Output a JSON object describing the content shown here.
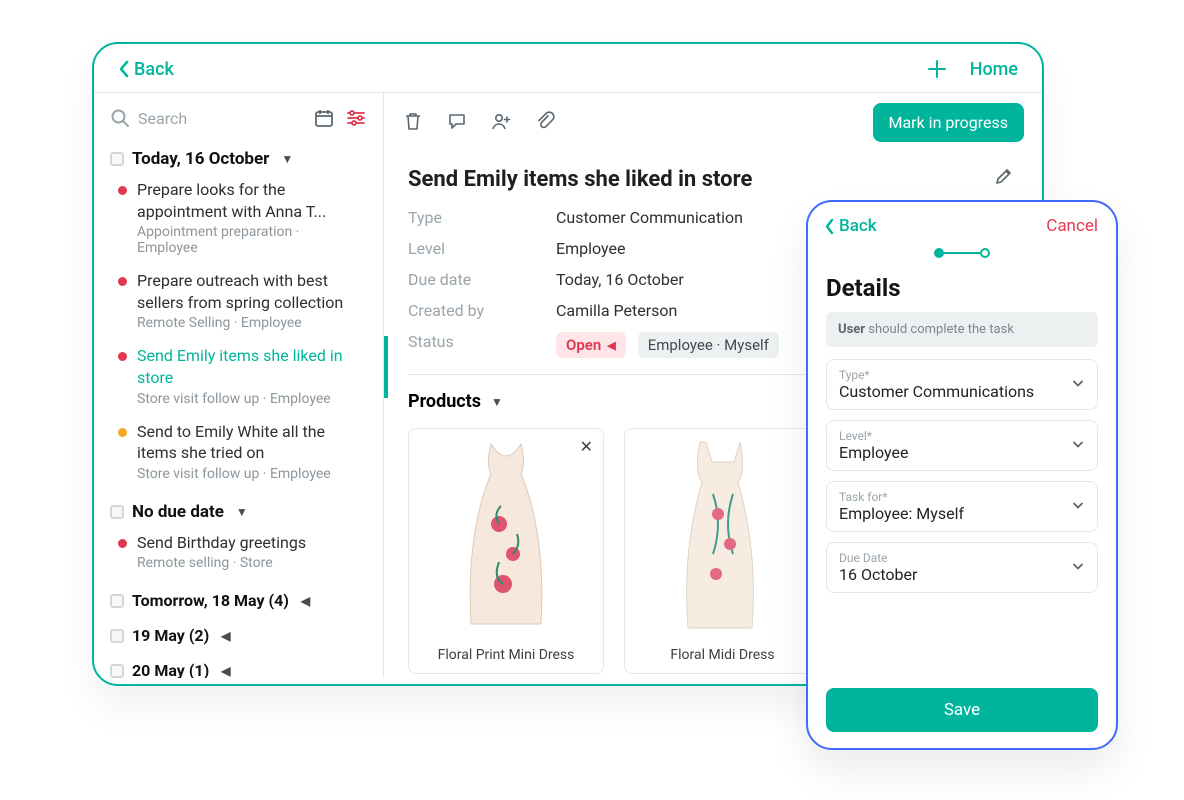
{
  "tablet": {
    "back": "Back",
    "home": "Home",
    "search_placeholder": "Search",
    "mark_in_progress": "Mark in progress",
    "groups": [
      {
        "heading": "Today, 16 October",
        "tasks": [
          {
            "dot": "red",
            "title": "Prepare looks for the appointment with Anna T...",
            "meta": "Appointment preparation · Employee"
          },
          {
            "dot": "red",
            "title": "Prepare outreach with best sellers from spring collection",
            "meta": "Remote Selling · Employee"
          },
          {
            "dot": "red",
            "title": "Send Emily items she liked in store",
            "meta": "Store visit follow up · Employee",
            "current": true
          },
          {
            "dot": "amber",
            "title": "Send to Emily White all the items she tried on",
            "meta": "Store visit follow up · Employee"
          }
        ]
      },
      {
        "heading": "No due date",
        "tasks": [
          {
            "dot": "red",
            "title": "Send Birthday greetings",
            "meta": "Remote selling · Store"
          }
        ]
      }
    ],
    "collapsed": [
      "Tomorrow, 18 May (4)",
      "19 May (2)",
      "20 May (1)"
    ],
    "detail": {
      "title": "Send Emily items she liked in store",
      "type": "Customer Communication",
      "level": "Employee",
      "due": "Today, 16 October",
      "created_by": "Camilla Peterson",
      "status_label": "Status",
      "open": "Open",
      "who": "Employee · Myself",
      "products_heading": "Products",
      "products": [
        {
          "name": "Floral Print Mini Dress"
        },
        {
          "name": "Floral Midi Dress"
        }
      ],
      "labels": {
        "type": "Type",
        "level": "Level",
        "due": "Due date",
        "created_by": "Created by"
      }
    }
  },
  "phone": {
    "back": "Back",
    "cancel": "Cancel",
    "title": "Details",
    "hint_bold": "User",
    "hint_rest": " should complete the task",
    "fields": {
      "type": {
        "label": "Type*",
        "value": "Customer Communications"
      },
      "level": {
        "label": "Level*",
        "value": "Employee"
      },
      "task_for": {
        "label": "Task for*",
        "value": "Employee: Myself"
      },
      "due": {
        "label": "Due Date",
        "value": "16 October"
      }
    },
    "save": "Save"
  }
}
